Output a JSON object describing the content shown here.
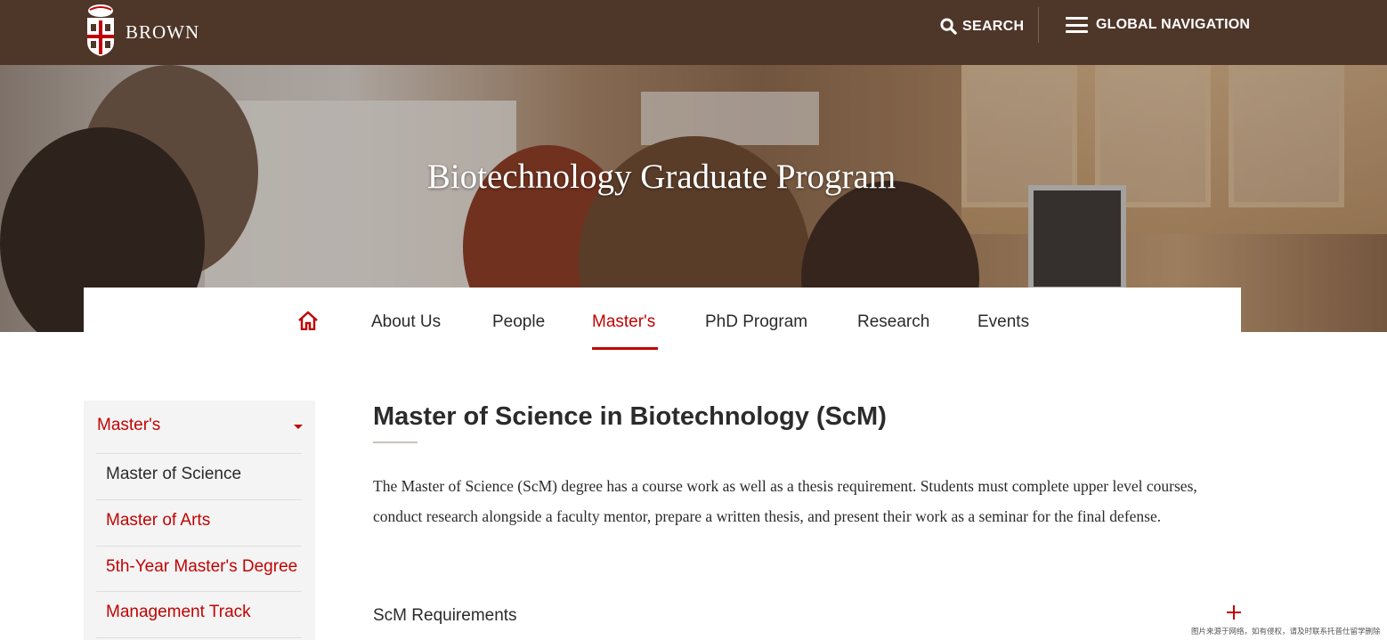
{
  "header": {
    "logo_text": "BROWN",
    "search_label": "SEARCH",
    "global_nav_label": "GLOBAL NAVIGATION",
    "bg_color": "#4e3629"
  },
  "hero": {
    "title": "Biotechnology Graduate Program"
  },
  "section_nav": {
    "items": [
      {
        "label": "About Us"
      },
      {
        "label": "People"
      },
      {
        "label": "Master's",
        "active": true
      },
      {
        "label": "PhD Program"
      },
      {
        "label": "Research"
      },
      {
        "label": "Events"
      }
    ],
    "accent": "#c00404"
  },
  "sidebar": {
    "heading": "Master's",
    "items": [
      {
        "label": "Master of Science",
        "current": true
      },
      {
        "label": "Master of Arts"
      },
      {
        "label": "5th-Year Master's Degree"
      },
      {
        "label": "Management Track"
      }
    ]
  },
  "main": {
    "title": "Master of Science in Biotechnology (ScM)",
    "intro": "The Master of Science (ScM) degree has a course work as well as a thesis requirement. Students must complete upper level courses, conduct research alongside a faculty mentor, prepare a written thesis, and present their work as a seminar for the final defense.",
    "accordion_label": "ScM Requirements"
  },
  "watermark": "图片来源于网络，如有侵权，请及时联系托普仕留学删除"
}
